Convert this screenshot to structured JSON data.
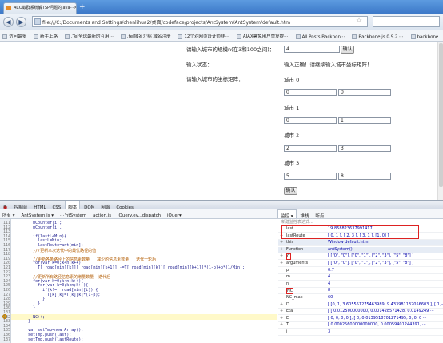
{
  "browser": {
    "tab_title": "ACO蚁群系统解TSP问题的Java⋯",
    "tab_close": "×",
    "new_tab": "+",
    "url": "file:///C:/Documents and Settings/chenlihua2/桌面/codeface/projects/AntSystem/AntSystem/default.htm",
    "nav_back": "◀",
    "nav_forward": "▶"
  },
  "bookmarks": [
    "访问最多",
    "新手上路",
    ".Tel全球最新的互用⋯",
    ".tel域名介绍 域名注册",
    "12个对网页设计师非⋯",
    "AJAX暑免用户重复提⋯",
    "All Posts  Backbon⋯",
    "Backbone.js 0.9.2 ⋯",
    "backbone"
  ],
  "form": {
    "size_label": "请输入城市的规模n(在3和100之间)：",
    "size_value": "4",
    "confirm_button": "确认",
    "status_label": "输入状态：",
    "status_value": "输入正确！请继续输入城市坐标矩阵！",
    "matrix_label": "请输入城市的坐标矩阵：",
    "cities": [
      {
        "name": "城市 0",
        "x": "0",
        "y": "0"
      },
      {
        "name": "城市 1",
        "x": "0",
        "y": "1"
      },
      {
        "name": "城市 2",
        "x": "2",
        "y": "3"
      },
      {
        "name": "城市 3",
        "x": "5",
        "y": "8"
      }
    ],
    "submit_button": "确认"
  },
  "firebug": {
    "top_tabs": [
      "控制台",
      "HTML",
      "CSS",
      "脚本",
      "DOM",
      "网络",
      "Cookies"
    ],
    "script_toolbar": [
      "所有 ▾",
      "AntSystem.js ▾",
      "⋯'ntSystem",
      "action.js",
      "jQuery.ev...dispatch",
      "jQuer▾"
    ],
    "right_tabs": [
      "监控 ▾",
      "堆栈",
      "断点"
    ],
    "code_lines": [
      {
        "n": "111",
        "t": "        mCounter[i];"
      },
      {
        "n": "112",
        "t": "        mCounter[i]."
      },
      {
        "n": "113",
        "t": ""
      },
      {
        "n": "114",
        "t": "        if(lastL<Min){"
      },
      {
        "n": "115",
        "t": "          lastL=Min;"
      },
      {
        "n": "116",
        "t": "          lastRoute=ant[min];"
      },
      {
        "n": "117",
        "t": "        }//更新本次迭代中的最优路径的值"
      },
      {
        "n": "118",
        "t": ""
      },
      {
        "n": "119",
        "t": "        //更新各条路径上的信息素数量   减少的信息素数量   迭代一轮后"
      },
      {
        "n": "120",
        "t": "        for(var k=0;k<n;k++)"
      },
      {
        "n": "121",
        "t": "          T[ road[min][k]][ road[min][k+1]] -=T[ road[min][k]][ road[min][k+1]]*(1-p)+p*(1/Min);"
      },
      {
        "n": "122",
        "t": ""
      },
      {
        "n": "123",
        "t": "        //更新所有路径信息素的增量数量  迭代后"
      },
      {
        "n": "124",
        "t": "        for(var k=0;k<n;k++){"
      },
      {
        "n": "125",
        "t": "          for(var k=0;k<n;k++){"
      },
      {
        "n": "126",
        "t": "            if(k!=  road[min][i]) {"
      },
      {
        "n": "127",
        "t": "              T[k][k]=T[k][k]*(1-p);"
      },
      {
        "n": "128",
        "t": "            }"
      },
      {
        "n": "129",
        "t": "          }"
      },
      {
        "n": "130",
        "t": "        }"
      },
      {
        "n": "131",
        "t": ""
      },
      {
        "n": "132",
        "t": "        NC++;"
      },
      {
        "n": "133",
        "t": "      }"
      },
      {
        "n": "134",
        "t": ""
      },
      {
        "n": "135",
        "t": "      var setTmp=new Array();"
      },
      {
        "n": "136",
        "t": "      setTmp.push(last);"
      },
      {
        "n": "137",
        "t": "      setTmp.push(lastRoute);"
      }
    ],
    "watch_placeholder": "新建监控表达式...",
    "watch_rows": [
      {
        "k": "last",
        "v": "19.858823637991417",
        "exp": ""
      },
      {
        "k": "lastRoute",
        "v": "[ 0, 1 ], [ 2, 3 ], [ 3, 1 ], [1, 0] ]",
        "exp": "+"
      },
      {
        "k": "this",
        "v": "Window default.htm",
        "exp": "+"
      },
      {
        "k": "Function",
        "v": "antSystem()",
        "exp": "+"
      },
      {
        "k": "C",
        "v": "[ [\"0\", \"0\"], [\"0\", \"1\"], [\"2\", \"3\"], [\"5\", \"8\"] ]",
        "exp": "+"
      },
      {
        "k": "arguments",
        "v": "[ [\"0\", \"0\"], [\"0\", \"1\"], [\"2\", \"3\"], [\"5\", \"8\"] ]",
        "exp": "+"
      },
      {
        "k": "p",
        "v": "0.7",
        "exp": ""
      },
      {
        "k": "m",
        "v": "4",
        "exp": ""
      },
      {
        "k": "n",
        "v": "4",
        "exp": ""
      },
      {
        "k": "NC",
        "v": "8",
        "exp": ""
      },
      {
        "k": "NC_max",
        "v": "60",
        "exp": ""
      },
      {
        "k": "D",
        "v": "[ [0, 1, 3.605551275463989, 9.433981132056603 ], [ 1,⋯",
        "exp": "+"
      },
      {
        "k": "Eta",
        "v": "[ [ 0.012500000000, 0.001428571428, 0.0149249 ⋯",
        "exp": "+"
      },
      {
        "k": "E",
        "v": "[ 0, 0, 0, 0 ], [ 0, 0.0139518701271495, 0, 0, 0 ⋯",
        "exp": "+"
      },
      {
        "k": "T",
        "v": "[ 0.00025600000000000, 0.00059401244391, ⋯",
        "exp": "+"
      },
      {
        "k": "i",
        "v": "3",
        "exp": ""
      }
    ]
  }
}
